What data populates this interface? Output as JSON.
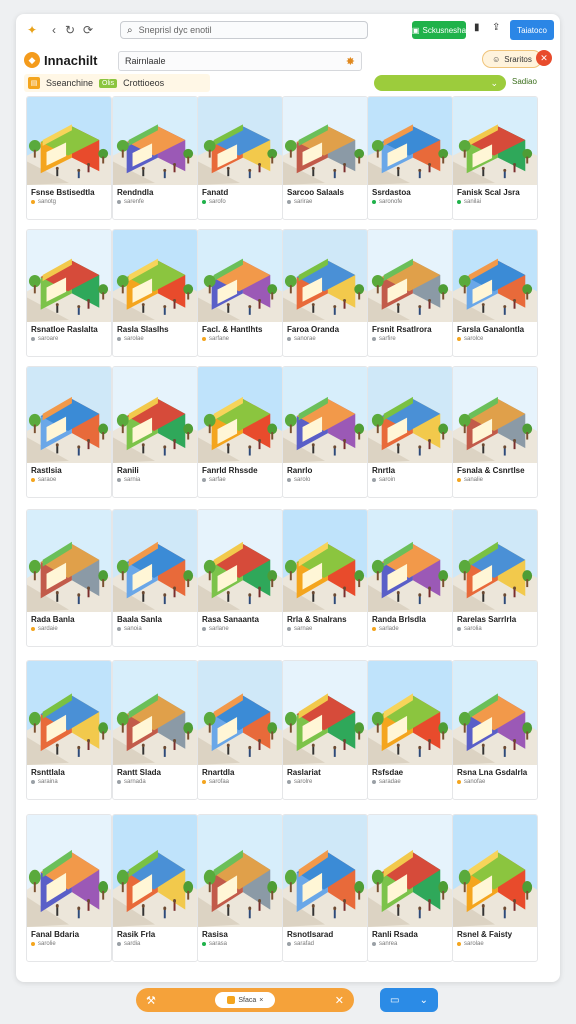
{
  "topbar": {
    "search_placeholder": "Sneprisl dyc enotil",
    "green_button": "Sckusnesha",
    "blue_button": "Taiatoco"
  },
  "header": {
    "logo": "Innachilt",
    "field_value": "Rairnlaale",
    "user_label": "Sraritos"
  },
  "filter": {
    "category_label": "Sseanchine",
    "category_tag": "Olis",
    "category_label2": "Crottioeos",
    "right_label": "Sadiao"
  },
  "colors": {
    "accent_orange": "#f5a23a",
    "accent_green": "#1fb24a",
    "accent_blue": "#2b86e6",
    "bar_green": "#9ccc3c",
    "danger": "#e84b2c"
  },
  "cards": [
    {
      "title": "Fsnse Bstisedtla",
      "meta": "sanotg",
      "dot": "#f4a51e"
    },
    {
      "title": "Rendndla",
      "meta": "sarenfe",
      "dot": "#9aa0a6"
    },
    {
      "title": "Fanatd",
      "meta": "sarofo",
      "dot": "#1fb24a"
    },
    {
      "title": "Sarcoo Salaals",
      "meta": "sarirae",
      "dot": "#9aa0a6"
    },
    {
      "title": "Ssrdastoa",
      "meta": "saronofe",
      "dot": "#1fb24a"
    },
    {
      "title": "Fanisk Scal Jsra",
      "meta": "sanilai",
      "dot": "#1fb24a"
    },
    {
      "title": "Rsnatloe Raslalta",
      "meta": "saroare",
      "dot": "#9aa0a6"
    },
    {
      "title": "Rasla Slaslhs",
      "meta": "sarolae",
      "dot": "#9aa0a6"
    },
    {
      "title": "Facl. & Hantlhts",
      "meta": "sarfane",
      "dot": "#f4a51e"
    },
    {
      "title": "Faroa Oranda",
      "meta": "sanorae",
      "dot": "#9aa0a6"
    },
    {
      "title": "Frsnit Rsatlrora",
      "meta": "sarfire",
      "dot": "#9aa0a6"
    },
    {
      "title": "Farsla Ganalontla",
      "meta": "sarolce",
      "dot": "#f4a51e"
    },
    {
      "title": "Rastlsia",
      "meta": "saraoe",
      "dot": "#f4a51e"
    },
    {
      "title": "Ranili",
      "meta": "sarnia",
      "dot": "#9aa0a6"
    },
    {
      "title": "Fanrld Rhssde",
      "meta": "sarfae",
      "dot": "#9aa0a6"
    },
    {
      "title": "Ranrlo",
      "meta": "sarolo",
      "dot": "#9aa0a6"
    },
    {
      "title": "Rnrtla",
      "meta": "saroin",
      "dot": "#9aa0a6"
    },
    {
      "title": "Fsnala & Csnrtlse",
      "meta": "sanalie",
      "dot": "#f4a51e"
    },
    {
      "title": "Rada Banla",
      "meta": "sardaie",
      "dot": "#f4a51e"
    },
    {
      "title": "Baala Sanla",
      "meta": "sanoia",
      "dot": "#9aa0a6"
    },
    {
      "title": "Rasa Sanaanta",
      "meta": "sarlane",
      "dot": "#9aa0a6"
    },
    {
      "title": "Rrla & Snalrans",
      "meta": "sarnae",
      "dot": "#9aa0a6"
    },
    {
      "title": "Randa Brlsdla",
      "meta": "sarlade",
      "dot": "#f4a51e"
    },
    {
      "title": "Rarelas Sarrlrla",
      "meta": "sarolia",
      "dot": "#9aa0a6"
    },
    {
      "title": "Rsnttlala",
      "meta": "saraina",
      "dot": "#9aa0a6"
    },
    {
      "title": "Rantt Slada",
      "meta": "sarnada",
      "dot": "#9aa0a6"
    },
    {
      "title": "Rnartdla",
      "meta": "sarofaa",
      "dot": "#f4a51e"
    },
    {
      "title": "Raslariat",
      "meta": "sarolre",
      "dot": "#9aa0a6"
    },
    {
      "title": "Rsfsdae",
      "meta": "saradae",
      "dot": "#9aa0a6"
    },
    {
      "title": "Rsna Lna Gsdalrla",
      "meta": "sanofae",
      "dot": "#f4a51e"
    },
    {
      "title": "Fanal Bdaria",
      "meta": "sarolie",
      "dot": "#f4a51e"
    },
    {
      "title": "Rasik Frla",
      "meta": "sardia",
      "dot": "#9aa0a6"
    },
    {
      "title": "Rasisa",
      "meta": "sarasa",
      "dot": "#1fb24a"
    },
    {
      "title": "Rsnotlsarad",
      "meta": "sarafad",
      "dot": "#9aa0a6"
    },
    {
      "title": "Ranli Rsada",
      "meta": "sanrea",
      "dot": "#9aa0a6"
    },
    {
      "title": "Rsnel & Faisty",
      "meta": "sarolae",
      "dot": "#f4a51e"
    }
  ],
  "bottom": {
    "pill_label": "Sfaca"
  }
}
